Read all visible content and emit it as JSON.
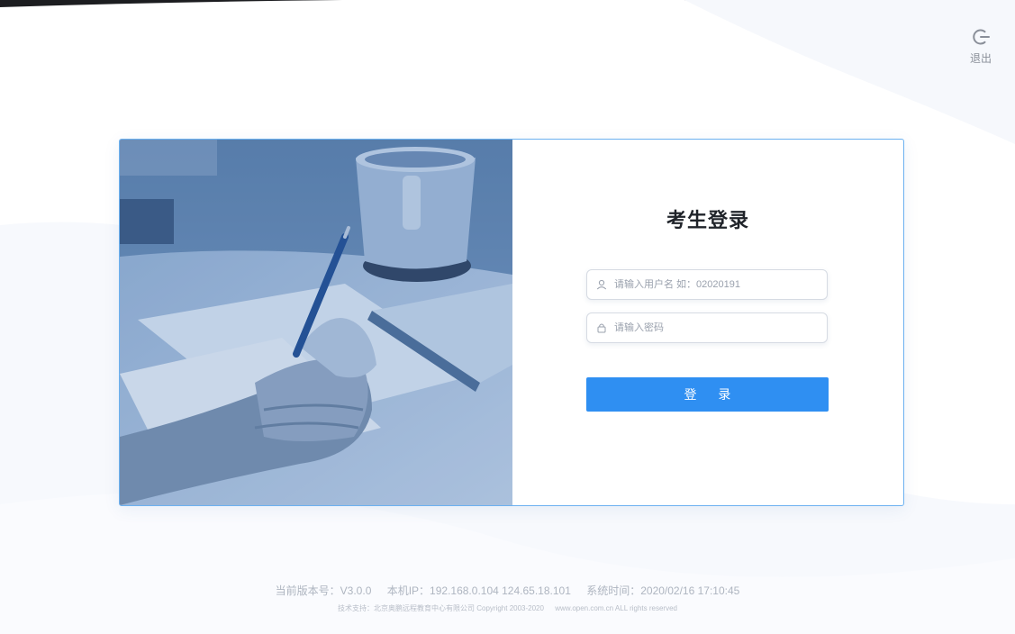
{
  "header": {
    "logout_label": "退出",
    "logout_icon": "power-off-icon"
  },
  "login": {
    "title": "考生登录",
    "username_placeholder": "请输入用户名 如：02020191",
    "username_value": "",
    "username_icon": "user-icon",
    "password_placeholder": "请输入密码",
    "password_value": "",
    "password_icon": "lock-icon",
    "submit_label": "登 录"
  },
  "footer": {
    "version": "当前版本号：V3.0.0",
    "ip": "本机IP：192.168.0.104 124.65.18.101",
    "time": "系统时间：2020/02/16 17:10:45",
    "support": "技术支持：北京奥鹏远程教育中心有限公司 Copyright 2003-2020",
    "site": "www.open.com.cn ALL rights reserved"
  },
  "colors": {
    "accent": "#2f8ff2",
    "card_border": "#6cb1f0",
    "background": "#ffffff",
    "corner_dark": "#1c1d20"
  }
}
